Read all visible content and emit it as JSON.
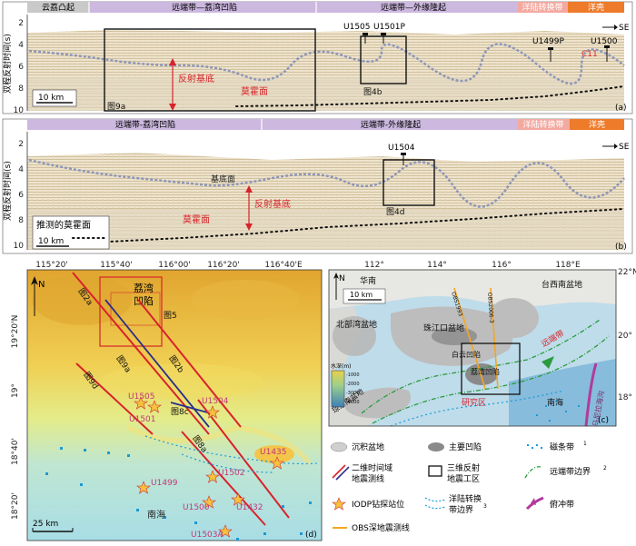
{
  "colors": {
    "grey_band": "#c9c9c9",
    "distal_band": "#cdb8e0",
    "transition_band": "#f3a9a0",
    "oceanic_band": "#ee7b2a",
    "seismic_light": "#eee4cf",
    "seismic_dark": "#c9b48a",
    "basement_line": "#8e96b8",
    "moho_dots": "#111111",
    "survey_line": "#d8232a",
    "obs_line": "#f5a623"
  },
  "panel_a": {
    "bands": [
      "云荔凸起",
      "远端带—荔湾凹陷",
      "远端带—外缘隆起",
      "洋陆转换带",
      "洋壳"
    ],
    "ylabel": "双程反射时间(s)",
    "yticks": [
      "2",
      "4",
      "6",
      "8",
      "10"
    ],
    "se_label": "SE",
    "sites": [
      "U1505",
      "U1501P",
      "U1499P",
      "U1500",
      "C11"
    ],
    "box_labels": [
      "图9a",
      "图4b"
    ],
    "annotations": [
      "反射基底",
      "莫霍面"
    ],
    "scale": "10 km",
    "panel_label": "(a)"
  },
  "panel_b": {
    "bands": [
      "远端带-荔湾凹陷",
      "远端带-外缘隆起",
      "洋陆转换带",
      "洋壳"
    ],
    "ylabel": "双程反射时间(s)",
    "yticks": [
      "2",
      "4",
      "6",
      "8",
      "10"
    ],
    "se_label": "SE",
    "sites": [
      "U1504"
    ],
    "box_labels": [
      "图4d"
    ],
    "annotations": [
      "基底面",
      "反射基底",
      "莫霍面"
    ],
    "legend_note": "推测的莫霍面",
    "scale": "10 km",
    "panel_label": "(b)"
  },
  "panel_d": {
    "lon_ticks": [
      "115°20'",
      "115°40'",
      "116°00'",
      "116°20'",
      "116°40'E"
    ],
    "lat_ticks": [
      "19°20'N",
      "19°",
      "18°40'",
      "18°20'"
    ],
    "north": "N",
    "sag_label_1": "荔湾",
    "sag_label_2": "凹陷",
    "line_labels": [
      "图2a",
      "图5",
      "图9a",
      "图2b",
      "图9d",
      "图8c",
      "图8a"
    ],
    "sites": [
      "U1505",
      "U1501",
      "U1504",
      "U1435",
      "U1502",
      "U1499",
      "U1500",
      "U1432",
      "U1503A"
    ],
    "sea_label": "南海",
    "scale": "25 km",
    "panel_label": "(d)"
  },
  "panel_c": {
    "lon_ticks": [
      "112°",
      "114°",
      "116°",
      "118°E"
    ],
    "lat_ticks": [
      "22°N",
      "20°",
      "18°"
    ],
    "north": "N",
    "scale": "10 km",
    "place_names": [
      "华南",
      "北部湾盆地",
      "珠江口盆地",
      "台西南盆地",
      "白云凹陷",
      "荔湾凹陷",
      "琼东南盆地",
      "南海",
      "研究区",
      "马尼拉海沟",
      "远端带",
      "OBS1993",
      "OBS2006-3"
    ],
    "depth_title": "水深(m)",
    "depth_ticks": [
      "-1000",
      "-2000",
      "-3000",
      "-4000"
    ],
    "panel_label": "(c)"
  },
  "legend": {
    "items": [
      {
        "icon": "sedimentary-basin-icon",
        "label": "沉积盆地"
      },
      {
        "icon": "main-sag-icon",
        "label": "主要凹陷"
      },
      {
        "icon": "magnetic-belt-icon",
        "label": "磁条带",
        "sup": "1"
      },
      {
        "icon": "seismic-line-icon",
        "label": "二维时间域\n地震测线"
      },
      {
        "icon": "3d-survey-icon",
        "label": "三维反射\n地震工区"
      },
      {
        "icon": "distal-boundary-icon",
        "label": "远端带边界",
        "sup": "2"
      },
      {
        "icon": "iodp-site-icon",
        "label": "IODP钻探站位"
      },
      {
        "icon": "oct-boundary-icon",
        "label": "洋陆转换\n带边界",
        "sup": "3"
      },
      {
        "icon": "subduction-zone-icon",
        "label": "俯冲带"
      },
      {
        "icon": "obs-line-icon",
        "label": "OBS深地震测线"
      }
    ]
  }
}
